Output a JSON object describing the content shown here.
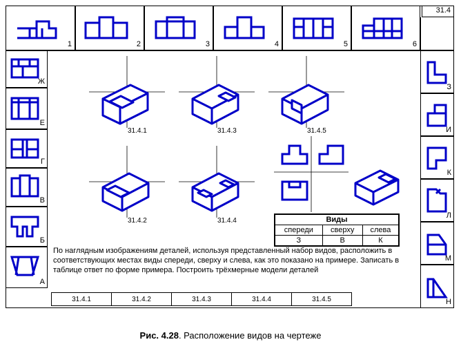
{
  "badge": "31.4",
  "top_numbers": [
    "1",
    "2",
    "3",
    "4",
    "5",
    "6"
  ],
  "left_letters": [
    "Ж",
    "Е",
    "Г",
    "В",
    "Б",
    "А"
  ],
  "right_letters": [
    "З",
    "И",
    "К",
    "Л",
    "М",
    "Н"
  ],
  "iso_labels": [
    "31.4.1",
    "31.4.3",
    "31.4.5",
    "31.4.2",
    "31.4.4"
  ],
  "views_table": {
    "title": "Виды",
    "headers": [
      "спереди",
      "сверху",
      "слева"
    ],
    "example": [
      "З",
      "В",
      "К"
    ]
  },
  "task_text": "По наглядным изображениям деталей, используя представленный набор видов, расположить в соответствующих местах виды спереди, сверху и слева, как это показано на примере. Записать в таблице ответ по форме примера. Построить трёхмерные модели деталей",
  "answer_headers": [
    "31.4.1",
    "31.4.2",
    "31.4.3",
    "31.4.4",
    "31.4.5"
  ],
  "caption_strong": "Рис. 4.28",
  "caption_rest": ". Расположение видов на чертеже"
}
